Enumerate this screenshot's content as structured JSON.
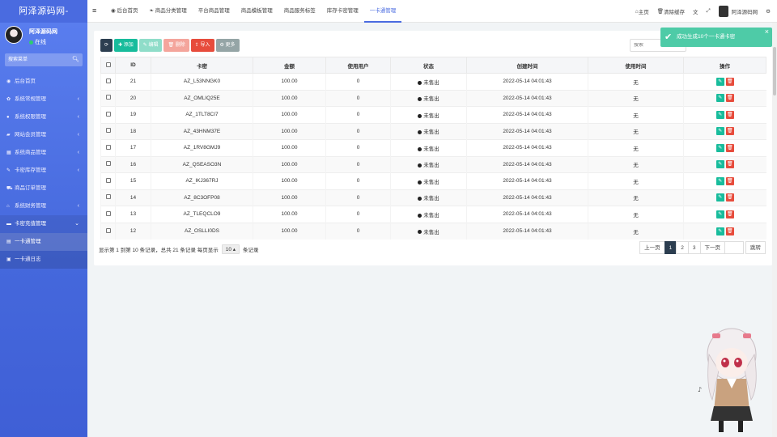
{
  "sidebar": {
    "brand": "阿泽源码网-",
    "user_name": "阿泽源码网",
    "user_status": "在线",
    "search_placeholder": "搜索菜单",
    "items": [
      {
        "label": "后台首页",
        "icon": "dashboard-icon"
      },
      {
        "label": "系统常规管理",
        "icon": "cogs-icon"
      },
      {
        "label": "系统权限管理",
        "icon": "users-icon"
      },
      {
        "label": "网站会员管理",
        "icon": "folder-icon"
      },
      {
        "label": "系统商品管理",
        "icon": "table-icon"
      },
      {
        "label": "卡密库存管理",
        "icon": "wrench-icon"
      },
      {
        "label": "商品订单管理",
        "icon": "cart-icon"
      },
      {
        "label": "系统财务管理",
        "icon": "bank-icon"
      },
      {
        "label": "卡密充值管理",
        "icon": "card-icon"
      }
    ],
    "subitems": [
      {
        "label": "一卡通管理",
        "icon": "list-icon"
      },
      {
        "label": "一卡通日志",
        "icon": "log-icon"
      }
    ]
  },
  "topbar": {
    "tabs": [
      "后台首页",
      "商品分类管理",
      "平台商品管理",
      "商品模板管理",
      "商品服务标签",
      "库存卡密管理",
      "一卡通管理"
    ],
    "active_tab": 6,
    "home": "主页",
    "clear_cache": "清除缓存",
    "admin_name": "阿泽源码网"
  },
  "toolbar": {
    "add": "添加",
    "edit": "编辑",
    "delete": "删除",
    "import": "导入",
    "more": "更多",
    "search_placeholder": "搜索"
  },
  "table": {
    "headers": [
      "ID",
      "卡密",
      "金额",
      "使用用户",
      "状态",
      "创建时间",
      "使用时间",
      "操作"
    ],
    "rows": [
      {
        "id": "21",
        "card": "AZ_L53NNGK0",
        "amount": "100.00",
        "user": "0",
        "status": "未售出",
        "created": "2022-05-14 04:01:43",
        "used": "无"
      },
      {
        "id": "20",
        "card": "AZ_OMLIQ25E",
        "amount": "100.00",
        "user": "0",
        "status": "未售出",
        "created": "2022-05-14 04:01:43",
        "used": "无"
      },
      {
        "id": "19",
        "card": "AZ_1TLT8CI7",
        "amount": "100.00",
        "user": "0",
        "status": "未售出",
        "created": "2022-05-14 04:01:43",
        "used": "无"
      },
      {
        "id": "18",
        "card": "AZ_43HNM37E",
        "amount": "100.00",
        "user": "0",
        "status": "未售出",
        "created": "2022-05-14 04:01:43",
        "used": "无"
      },
      {
        "id": "17",
        "card": "AZ_1RV8GMJ9",
        "amount": "100.00",
        "user": "0",
        "status": "未售出",
        "created": "2022-05-14 04:01:43",
        "used": "无"
      },
      {
        "id": "16",
        "card": "AZ_QSEASO3N",
        "amount": "100.00",
        "user": "0",
        "status": "未售出",
        "created": "2022-05-14 04:01:43",
        "used": "无"
      },
      {
        "id": "15",
        "card": "AZ_IKJ367RJ",
        "amount": "100.00",
        "user": "0",
        "status": "未售出",
        "created": "2022-05-14 04:01:43",
        "used": "无"
      },
      {
        "id": "14",
        "card": "AZ_8C3OFP08",
        "amount": "100.00",
        "user": "0",
        "status": "未售出",
        "created": "2022-05-14 04:01:43",
        "used": "无"
      },
      {
        "id": "13",
        "card": "AZ_TLEQCLO9",
        "amount": "100.00",
        "user": "0",
        "status": "未售出",
        "created": "2022-05-14 04:01:43",
        "used": "无"
      },
      {
        "id": "12",
        "card": "AZ_OSLLI0DS",
        "amount": "100.00",
        "user": "0",
        "status": "未售出",
        "created": "2022-05-14 04:01:43",
        "used": "无"
      }
    ]
  },
  "footer": {
    "info_prefix": "显示第 1 到第 10 条记录，总共 21 条记录 每页显示",
    "page_size": "10",
    "info_suffix": "条记录"
  },
  "pager": {
    "prev": "上一页",
    "pages": [
      "1",
      "2",
      "3"
    ],
    "active_page": "1",
    "next": "下一页",
    "go": "跳转"
  },
  "toast": {
    "message": "成功生成10个一卡通卡密"
  },
  "colors": {
    "sidebar": "#4568dc",
    "accent": "#4a6be0",
    "success": "#18bc9c",
    "danger": "#e74c3c",
    "dark": "#2c3e50"
  }
}
